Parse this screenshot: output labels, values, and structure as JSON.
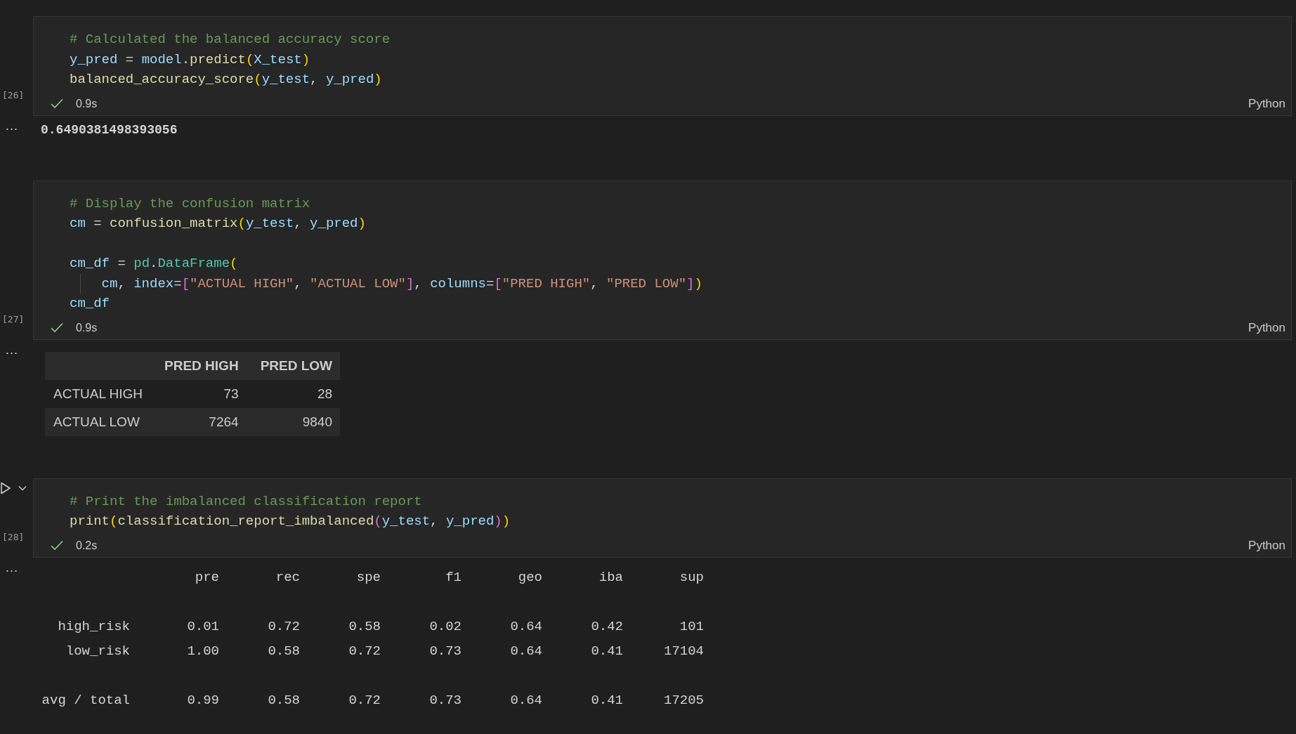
{
  "cells": [
    {
      "execution_count": "[26]",
      "toolbar_visible": false,
      "succeeded": true,
      "duration": "0.9s",
      "language": "Python",
      "lines": [
        {
          "kind": "code",
          "guide": false,
          "tokens": [
            {
              "text": "# Calculated the balanced accuracy score",
              "kind": "comment"
            }
          ]
        },
        {
          "kind": "code",
          "guide": false,
          "tokens": [
            {
              "text": "y_pred",
              "kind": "var"
            },
            {
              "text": " = ",
              "kind": "op"
            },
            {
              "text": "model",
              "kind": "var"
            },
            {
              "text": ".",
              "kind": "op"
            },
            {
              "text": "predict",
              "kind": "func"
            },
            {
              "text": "(",
              "kind": "bracket1"
            },
            {
              "text": "X_test",
              "kind": "var"
            },
            {
              "text": ")",
              "kind": "bracket1"
            }
          ]
        },
        {
          "kind": "code",
          "guide": false,
          "tokens": [
            {
              "text": "balanced_accuracy_score",
              "kind": "func"
            },
            {
              "text": "(",
              "kind": "bracket1"
            },
            {
              "text": "y_test",
              "kind": "var"
            },
            {
              "text": ", ",
              "kind": "op"
            },
            {
              "text": "y_pred",
              "kind": "var"
            },
            {
              "text": ")",
              "kind": "bracket1"
            }
          ]
        }
      ],
      "output": {
        "kind": "text",
        "more": "...",
        "text": "0.6490381498393056"
      }
    },
    {
      "execution_count": "[27]",
      "toolbar_visible": false,
      "succeeded": true,
      "duration": "0.9s",
      "language": "Python",
      "lines": [
        {
          "kind": "code",
          "guide": false,
          "tokens": [
            {
              "text": "# Display the confusion matrix",
              "kind": "comment"
            }
          ]
        },
        {
          "kind": "code",
          "guide": false,
          "tokens": [
            {
              "text": "cm",
              "kind": "var"
            },
            {
              "text": " = ",
              "kind": "op"
            },
            {
              "text": "confusion_matrix",
              "kind": "func"
            },
            {
              "text": "(",
              "kind": "bracket1"
            },
            {
              "text": "y_test",
              "kind": "var"
            },
            {
              "text": ", ",
              "kind": "op"
            },
            {
              "text": "y_pred",
              "kind": "var"
            },
            {
              "text": ")",
              "kind": "bracket1"
            }
          ]
        },
        {
          "kind": "blank"
        },
        {
          "kind": "code",
          "guide": false,
          "tokens": [
            {
              "text": "cm_df",
              "kind": "var"
            },
            {
              "text": " = ",
              "kind": "op"
            },
            {
              "text": "pd",
              "kind": "class"
            },
            {
              "text": ".",
              "kind": "op"
            },
            {
              "text": "DataFrame",
              "kind": "class"
            },
            {
              "text": "(",
              "kind": "bracket1"
            }
          ]
        },
        {
          "kind": "code",
          "guide": true,
          "tokens": [
            {
              "text": "cm",
              "kind": "var"
            },
            {
              "text": ", ",
              "kind": "op"
            },
            {
              "text": "index",
              "kind": "var"
            },
            {
              "text": "=",
              "kind": "op"
            },
            {
              "text": "[",
              "kind": "bracket2"
            },
            {
              "text": "\"ACTUAL HIGH\"",
              "kind": "string"
            },
            {
              "text": ", ",
              "kind": "op"
            },
            {
              "text": "\"ACTUAL LOW\"",
              "kind": "string"
            },
            {
              "text": "]",
              "kind": "bracket2"
            },
            {
              "text": ", ",
              "kind": "op"
            },
            {
              "text": "columns",
              "kind": "var"
            },
            {
              "text": "=",
              "kind": "op"
            },
            {
              "text": "[",
              "kind": "bracket2"
            },
            {
              "text": "\"PRED HIGH\"",
              "kind": "string"
            },
            {
              "text": ", ",
              "kind": "op"
            },
            {
              "text": "\"PRED LOW\"",
              "kind": "string"
            },
            {
              "text": "]",
              "kind": "bracket2"
            },
            {
              "text": ")",
              "kind": "bracket1"
            }
          ]
        },
        {
          "kind": "code",
          "guide": false,
          "tokens": [
            {
              "text": "cm_df",
              "kind": "var"
            }
          ]
        }
      ],
      "output": {
        "kind": "table",
        "more": "...",
        "columns": [
          "PRED HIGH",
          "PRED LOW"
        ],
        "rows": [
          {
            "label": "ACTUAL HIGH",
            "values": [
              "73",
              "28"
            ]
          },
          {
            "label": "ACTUAL LOW",
            "values": [
              "7264",
              "9840"
            ]
          }
        ]
      }
    },
    {
      "execution_count": "[28]",
      "toolbar_visible": true,
      "succeeded": true,
      "duration": "0.2s",
      "language": "Python",
      "lines": [
        {
          "kind": "code",
          "guide": false,
          "tokens": [
            {
              "text": "# Print the imbalanced classification report",
              "kind": "comment"
            }
          ]
        },
        {
          "kind": "code",
          "guide": false,
          "tokens": [
            {
              "text": "print",
              "kind": "func"
            },
            {
              "text": "(",
              "kind": "bracket1"
            },
            {
              "text": "classification_report_imbalanced",
              "kind": "func"
            },
            {
              "text": "(",
              "kind": "bracket2"
            },
            {
              "text": "y_test",
              "kind": "var"
            },
            {
              "text": ", ",
              "kind": "op"
            },
            {
              "text": "y_pred",
              "kind": "var"
            },
            {
              "text": ")",
              "kind": "bracket2"
            },
            {
              "text": ")",
              "kind": "bracket1"
            }
          ]
        }
      ],
      "output": {
        "kind": "report",
        "more": "...",
        "columns": [
          "pre",
          "rec",
          "spe",
          "f1",
          "geo",
          "iba",
          "sup"
        ],
        "groups": [
          [
            {
              "label": "high_risk",
              "values": [
                "0.01",
                "0.72",
                "0.58",
                "0.02",
                "0.64",
                "0.42",
                "101"
              ]
            },
            {
              "label": "low_risk",
              "values": [
                "1.00",
                "0.58",
                "0.72",
                "0.73",
                "0.64",
                "0.41",
                "17104"
              ]
            }
          ],
          [
            {
              "label": "avg / total",
              "values": [
                "0.99",
                "0.58",
                "0.72",
                "0.73",
                "0.64",
                "0.41",
                "17205"
              ]
            }
          ]
        ]
      }
    }
  ]
}
